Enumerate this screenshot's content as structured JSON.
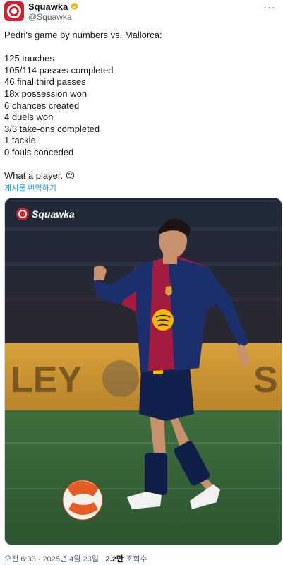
{
  "header": {
    "display_name": "Squawka",
    "handle": "@Squawka",
    "avatar_icon": "squawka-logo-icon",
    "verified_icon": "verified-badge-icon",
    "more_icon": "more-options-icon"
  },
  "tweet": {
    "lines": [
      "Pedri's game by numbers vs. Mallorca:",
      "",
      "125 touches",
      "105/114 passes completed",
      "46 final third passes",
      "18x possession won",
      "6 chances created",
      "4 duels won",
      "3/3 take-ons completed",
      "1 tackle",
      "0 fouls conceded",
      "",
      "What a player. 😍"
    ],
    "translate_label": "게시물 번역하기"
  },
  "media": {
    "logo_text": "Squawka",
    "board_text": "LEY",
    "board_text_right": "S"
  },
  "footer": {
    "time": "오전 6:33",
    "separator": "·",
    "date": "2025년 4월 23일",
    "views_count": "2.2만",
    "views_label": "조회수"
  },
  "colors": {
    "brand_red": "#d4202c",
    "link_blue": "#1d9bf0",
    "verified_gold": "#e2b719"
  }
}
